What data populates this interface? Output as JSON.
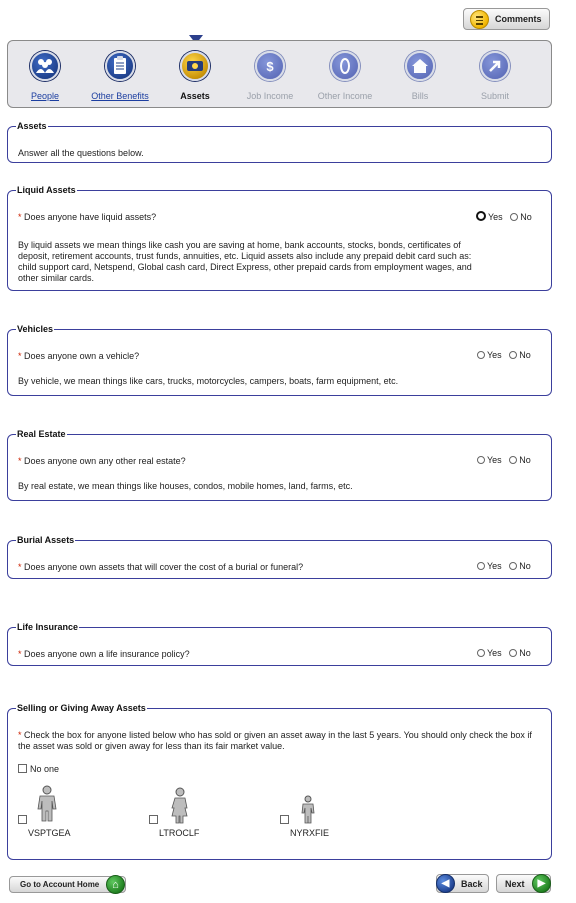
{
  "header": {
    "comments_label": "Comments"
  },
  "nav": {
    "steps": [
      {
        "label": "People",
        "icon": "people-icon",
        "state": "link"
      },
      {
        "label": "Other Benefits",
        "icon": "clipboard-icon",
        "state": "link"
      },
      {
        "label": "Assets",
        "icon": "money-icon",
        "state": "current"
      },
      {
        "label": "Job Income",
        "icon": "dollar-icon",
        "state": "disabled"
      },
      {
        "label": "Other Income",
        "icon": "coin-icon",
        "state": "disabled"
      },
      {
        "label": "Bills",
        "icon": "house-icon",
        "state": "disabled"
      },
      {
        "label": "Submit",
        "icon": "submit-arrow-icon",
        "state": "disabled"
      }
    ]
  },
  "assets": {
    "legend": "Assets",
    "instruction": "Answer all the questions below."
  },
  "yes_label": "Yes",
  "no_label": "No",
  "required_mark": "*",
  "liquid": {
    "legend": "Liquid Assets",
    "question": "Does anyone have liquid assets?",
    "note": "By liquid assets we mean things like cash you are saving at home, bank accounts, stocks, bonds, certificates of deposit, retirement accounts, trust funds, annuities, etc. Liquid assets also include any prepaid debit card such as: child support card, Netspend, Global cash card, Direct Express, other prepaid cards from employment wages, and other similar cards."
  },
  "vehicles": {
    "legend": "Vehicles",
    "question": "Does anyone own a vehicle?",
    "note": "By vehicle, we mean things like cars, trucks, motorcycles, campers, boats, farm equipment, etc."
  },
  "real_estate": {
    "legend": "Real Estate",
    "question": "Does anyone own any other real estate?",
    "note": "By real estate, we mean things like houses, condos, mobile homes, land, farms, etc."
  },
  "burial": {
    "legend": "Burial Assets",
    "question": "Does anyone own assets that will cover the cost of a burial or funeral?"
  },
  "life": {
    "legend": "Life Insurance",
    "question": "Does anyone own a life insurance policy?"
  },
  "selling": {
    "legend": "Selling or Giving Away Assets",
    "question": "Check the box for anyone listed below who has sold or given an asset away in the last 5 years. You should only check the box if the asset was sold or given away for less than its fair market value.",
    "no_one_label": "No one",
    "people": [
      {
        "name": "VSPTGEA",
        "figure": "adult-male-icon"
      },
      {
        "name": "LTROCLF",
        "figure": "adult-female-icon"
      },
      {
        "name": "NYRXFIE",
        "figure": "child-icon"
      }
    ]
  },
  "footer": {
    "home_label": "Go to Account Home",
    "back_label": "Back",
    "next_label": "Next"
  }
}
